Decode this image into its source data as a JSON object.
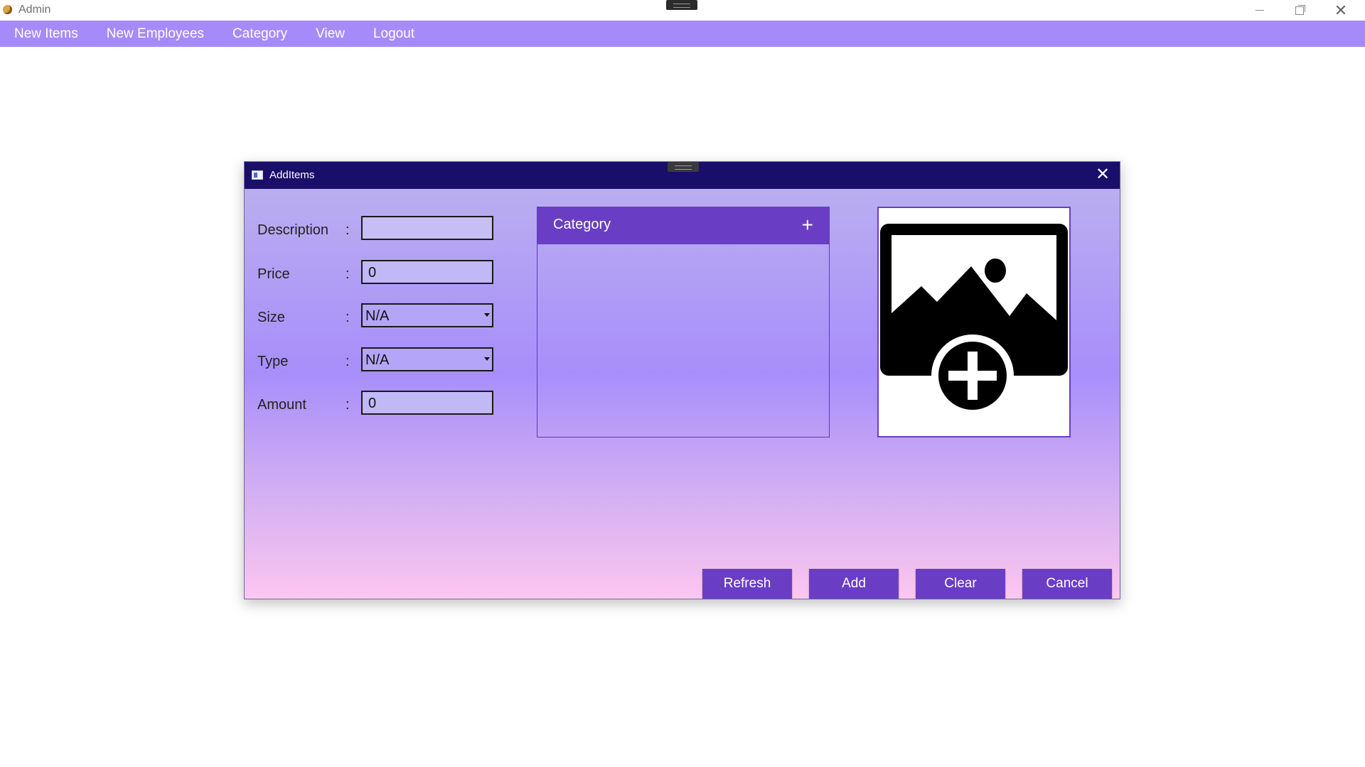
{
  "window": {
    "title": "Admin",
    "controls": {
      "minimize_icon": "minimize-icon",
      "maximize_icon": "restore-icon",
      "close_icon": "close-icon"
    }
  },
  "menu": {
    "items": [
      "New Items",
      "New Employees",
      "Category",
      "View",
      "Logout"
    ]
  },
  "dialog": {
    "title": "AddItems",
    "close_glyph": "✕",
    "form": {
      "description": {
        "label": "Description",
        "colon": ":",
        "value": ""
      },
      "price": {
        "label": "Price",
        "colon": ":",
        "value": "0"
      },
      "size": {
        "label": "Size",
        "colon": ":",
        "selected": "N/A"
      },
      "type": {
        "label": "Type",
        "colon": ":",
        "selected": "N/A"
      },
      "amount": {
        "label": "Amount",
        "colon": ":",
        "value": "0"
      }
    },
    "category_panel": {
      "title": "Category",
      "add_glyph": "+"
    },
    "image_placeholder": {
      "icon": "add-image-icon"
    },
    "buttons": {
      "refresh": "Refresh",
      "add": "Add",
      "clear": "Clear",
      "cancel": "Cancel"
    }
  },
  "colors": {
    "menubar": "#a58bfa",
    "dialog_titlebar": "#1a0e6b",
    "accent": "#6a3ec4",
    "gradient_top": "#baaef0",
    "gradient_bottom": "#fcc6ef"
  }
}
